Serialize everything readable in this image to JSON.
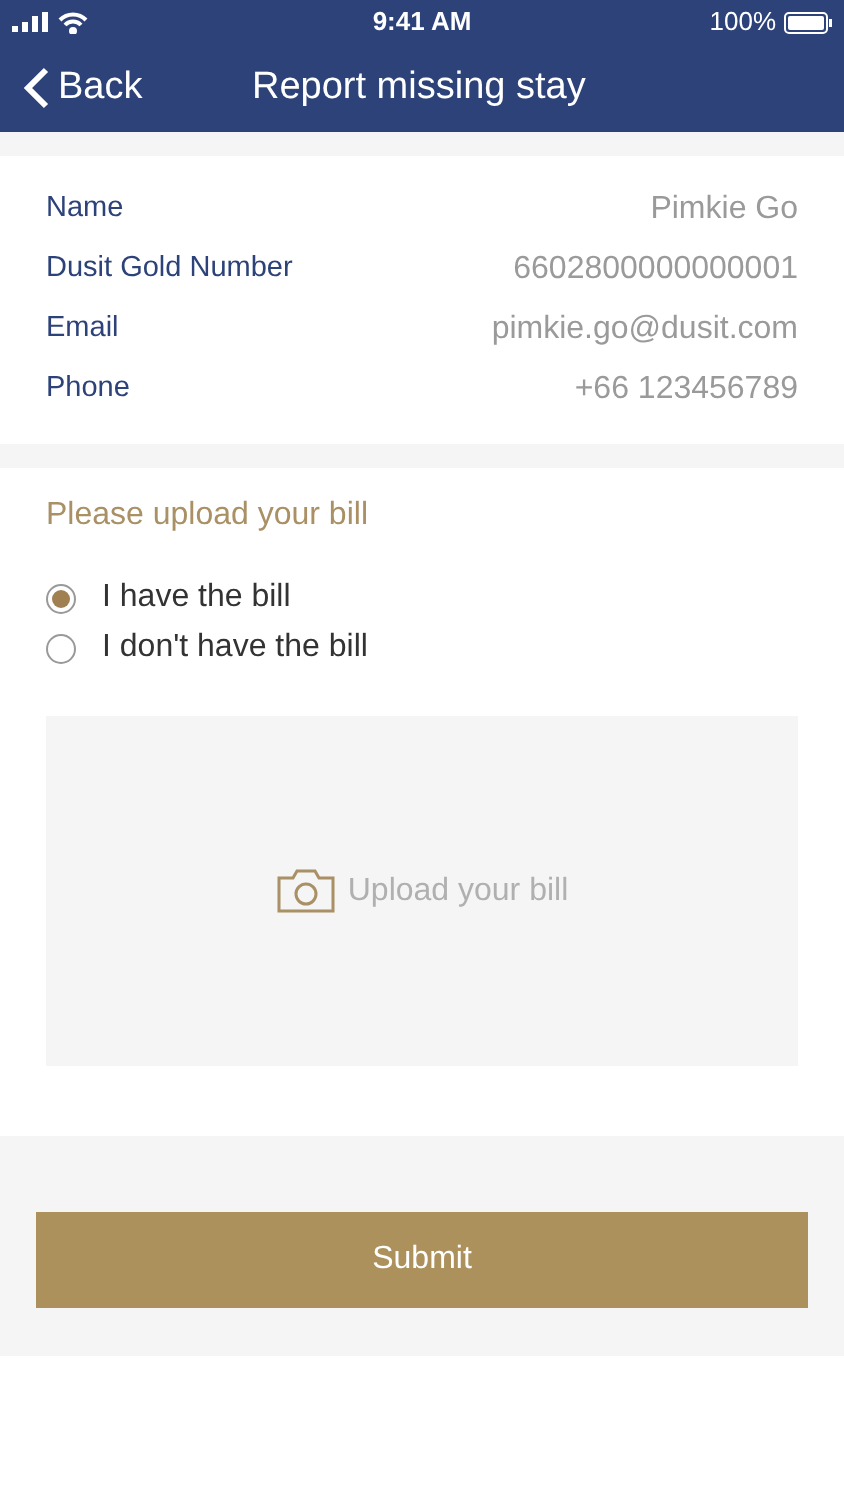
{
  "status_bar": {
    "time": "9:41 AM",
    "battery": "100%"
  },
  "nav": {
    "back": "Back",
    "title": "Report missing stay"
  },
  "profile": [
    {
      "label": "Name",
      "value": "Pimkie Go"
    },
    {
      "label": "Dusit Gold Number",
      "value": "6602800000000001"
    },
    {
      "label": "Email",
      "value": "pimkie.go@dusit.com"
    },
    {
      "label": "Phone",
      "value": "+66 123456789"
    }
  ],
  "upload": {
    "heading": "Please upload your bill",
    "options": [
      {
        "label": "I have the bill",
        "selected": true
      },
      {
        "label": "I don't have the bill",
        "selected": false
      }
    ],
    "dropzone": "Upload your bill"
  },
  "submit": "Submit"
}
